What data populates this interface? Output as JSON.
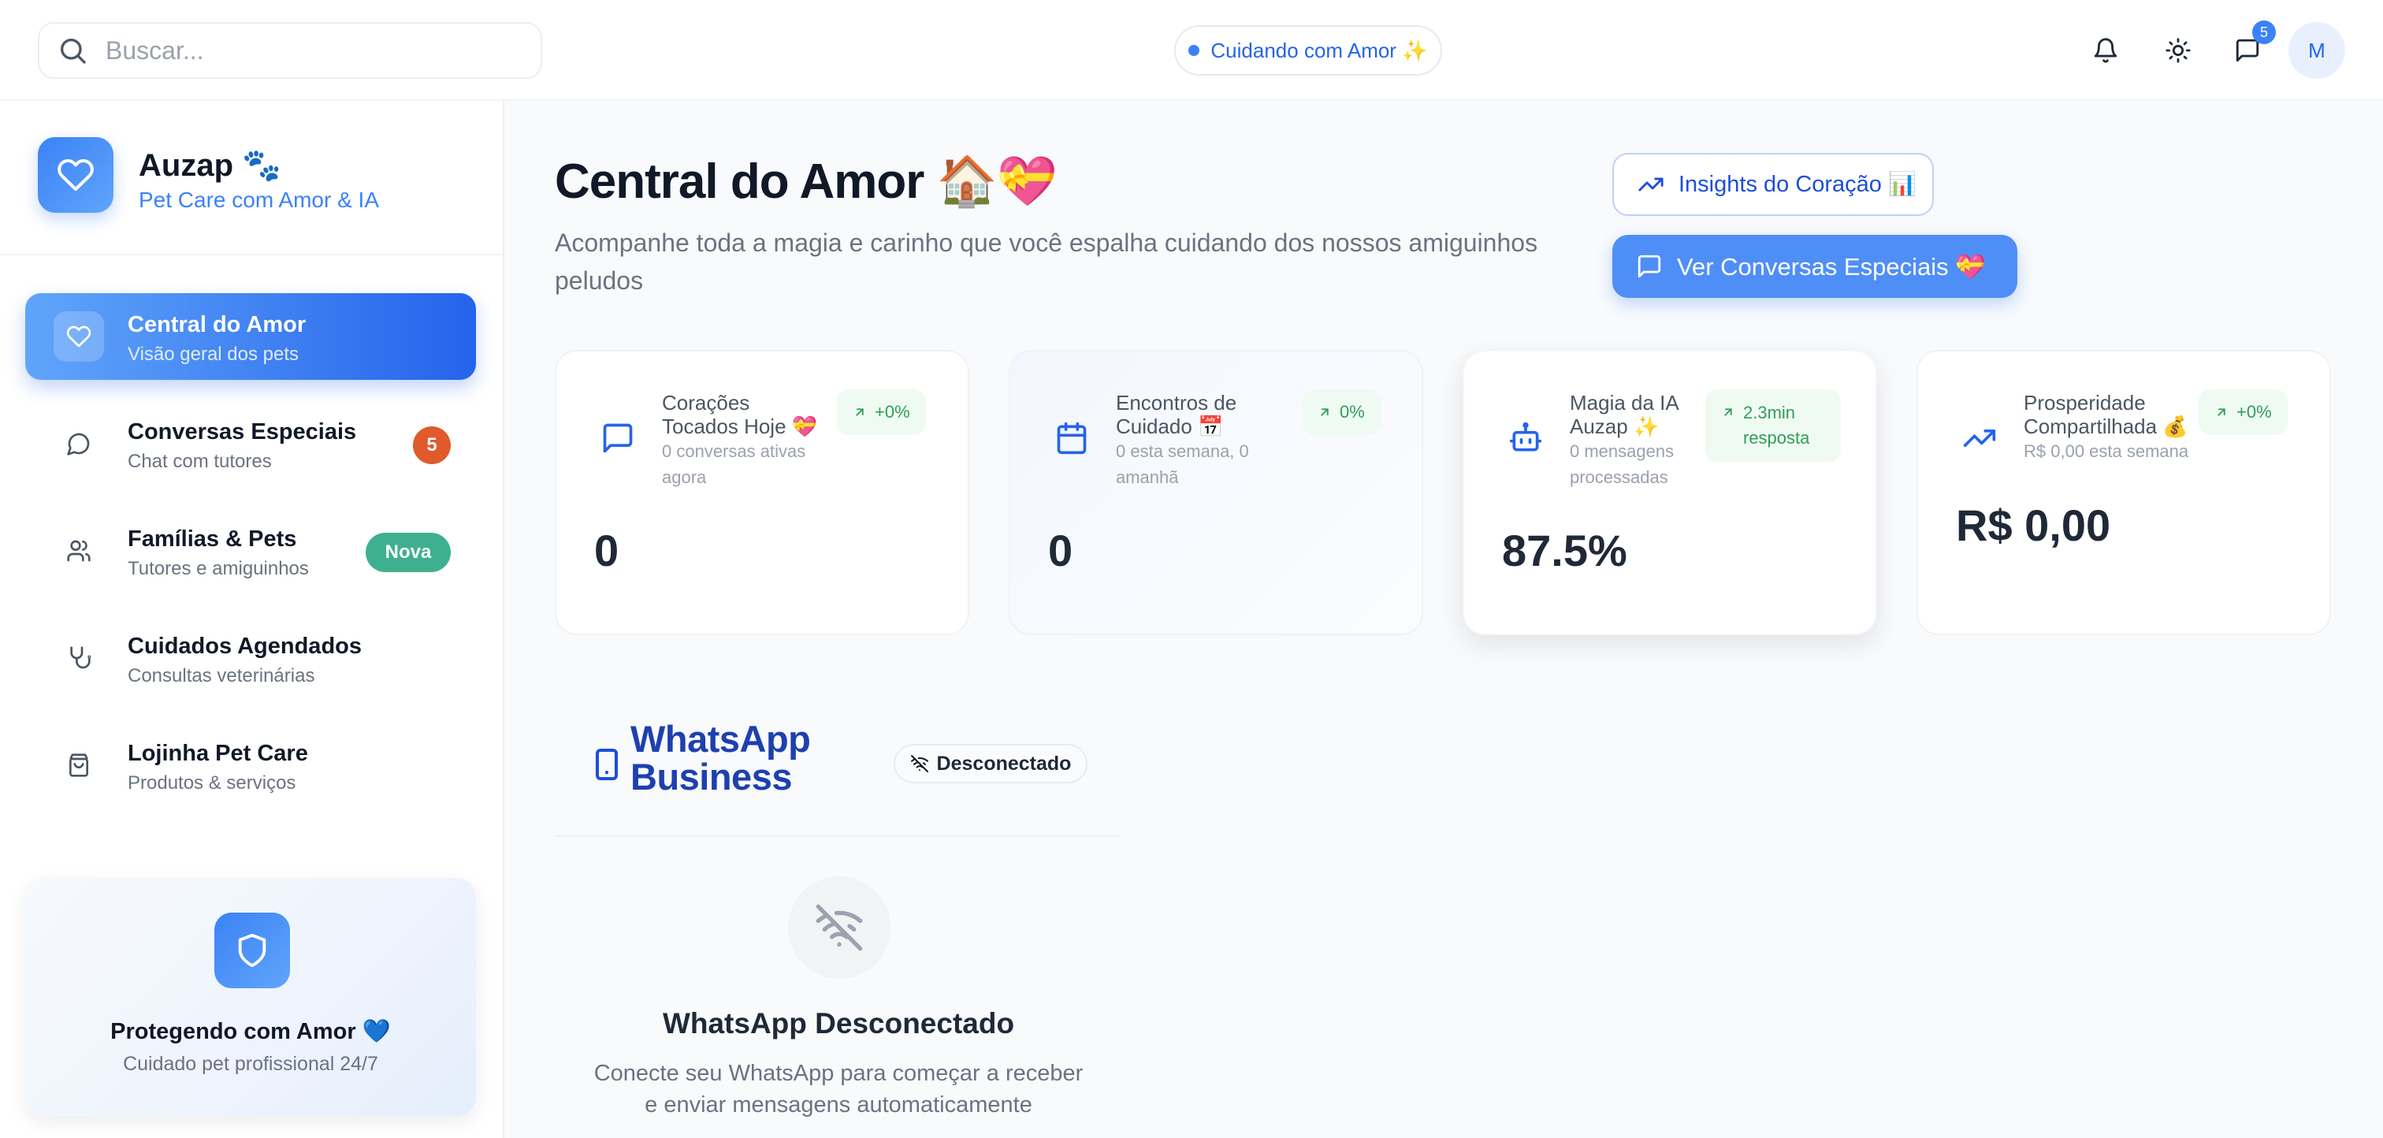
{
  "search": {
    "placeholder": "Buscar..."
  },
  "topbar": {
    "status_label": "Cuidando com Amor ✨",
    "notifications_badge": "5",
    "avatar_initial": "M",
    "accent_color": "#3b82f6"
  },
  "brand": {
    "name": "Auzap 🐾",
    "tagline": "Pet Care com Amor & IA"
  },
  "sidebar": {
    "items": [
      {
        "title": "Central do Amor",
        "subtitle": "Visão geral dos pets",
        "icon": "heart-icon",
        "active": true
      },
      {
        "title": "Conversas Especiais",
        "subtitle": "Chat com tutores",
        "icon": "chat-icon",
        "badge": "5"
      },
      {
        "title": "Famílias & Pets",
        "subtitle": "Tutores e amiguinhos",
        "icon": "users-icon",
        "badge": "Nova"
      },
      {
        "title": "Cuidados Agendados",
        "subtitle": "Consultas veterinárias",
        "icon": "stethoscope-icon"
      },
      {
        "title": "Lojinha Pet Care",
        "subtitle": "Produtos & serviços",
        "icon": "shopping-bag-icon"
      }
    ],
    "protect_card": {
      "title": "Protegendo com Amor 💙",
      "subtitle": "Cuidado pet profissional 24/7"
    }
  },
  "main": {
    "title": "Central do Amor 🏠💝",
    "description": "Acompanhe toda a magia e carinho que você espalha cuidando dos nossos amiguinhos peludos",
    "insights_button": "Insights do Coração 📊",
    "conversations_button": "Ver  Conversas Especiais 💝"
  },
  "stats": [
    {
      "title": "Corações Tocados Hoje 💝",
      "subtitle": "0 conversas ativas agora",
      "badge": "+0%",
      "value": "0",
      "icon": "chat-icon"
    },
    {
      "title": "Encontros de Cuidado 📅",
      "subtitle": "0 esta semana, 0 amanhã",
      "badge": "0%",
      "value": "0",
      "icon": "calendar-icon"
    },
    {
      "title": "Magia da IA Auzap ✨",
      "subtitle": "0 mensagens processadas",
      "badge": "2.3min resposta",
      "value": "87.5%",
      "icon": "bot-icon"
    },
    {
      "title": "Prosperidade Compartilhada 💰",
      "subtitle": "R$ 0,00 esta semana",
      "badge": "+0%",
      "value": "R$ 0,00",
      "icon": "trending-up-icon"
    }
  ],
  "whatsapp": {
    "title": "WhatsApp Business",
    "status": "Desconectado",
    "disconnected_title": "WhatsApp Desconectado",
    "disconnected_desc": "Conecte seu WhatsApp para começar a receber e enviar mensagens automaticamente"
  }
}
